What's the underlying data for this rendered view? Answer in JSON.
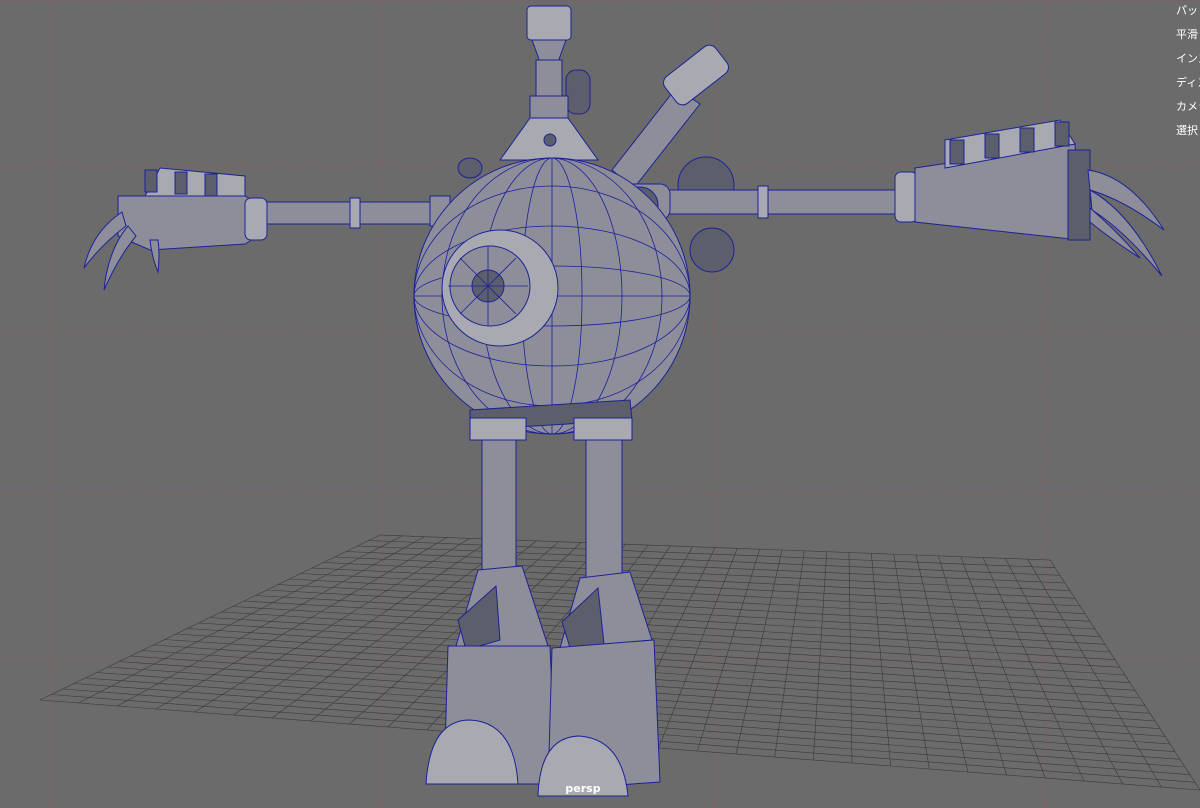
{
  "viewport": {
    "camera_label": "persp",
    "background_color": "#6b6b6b",
    "wireframe_color": "#1c2296",
    "mesh_color": "#8e8e9a"
  },
  "panel_menu": [
    {
      "label": "パッ"
    },
    {
      "label": "平滑"
    },
    {
      "label": "インス"
    },
    {
      "label": "ディス"
    },
    {
      "label": "カメラ"
    },
    {
      "label": "選択"
    }
  ]
}
